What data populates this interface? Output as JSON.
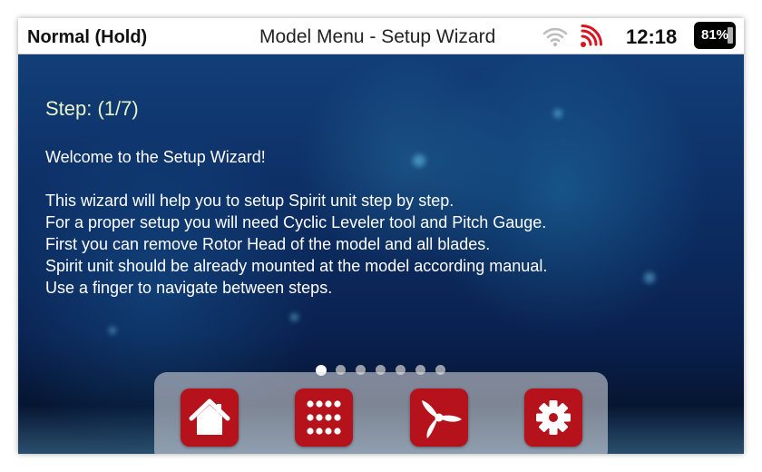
{
  "status_bar": {
    "mode": "Normal (Hold)",
    "title": "Model Menu - Setup Wizard",
    "time": "12:18",
    "battery": "81%",
    "wifi_icon": "wifi-icon",
    "signal_icon": "rc-signal-icon",
    "signal_color": "#d9141e"
  },
  "wizard": {
    "step": "Step: (1/7)",
    "welcome": "Welcome to the Setup Wizard!",
    "lines": [
      "This wizard will help you to setup Spirit unit step by step.",
      "For a proper setup you will need Cyclic Leveler tool and Pitch Gauge.",
      "First you can remove Rotor Head of the model and all blades.",
      "Spirit unit should be already mounted at the model according manual.",
      "Use a finger to navigate between steps."
    ],
    "page_count": 7,
    "current_page": 1
  },
  "dock": {
    "button_color": "#b5121b",
    "buttons": [
      {
        "icon": "home-icon"
      },
      {
        "icon": "apps-grid-icon"
      },
      {
        "icon": "rotor-icon"
      },
      {
        "icon": "gear-icon"
      }
    ]
  }
}
